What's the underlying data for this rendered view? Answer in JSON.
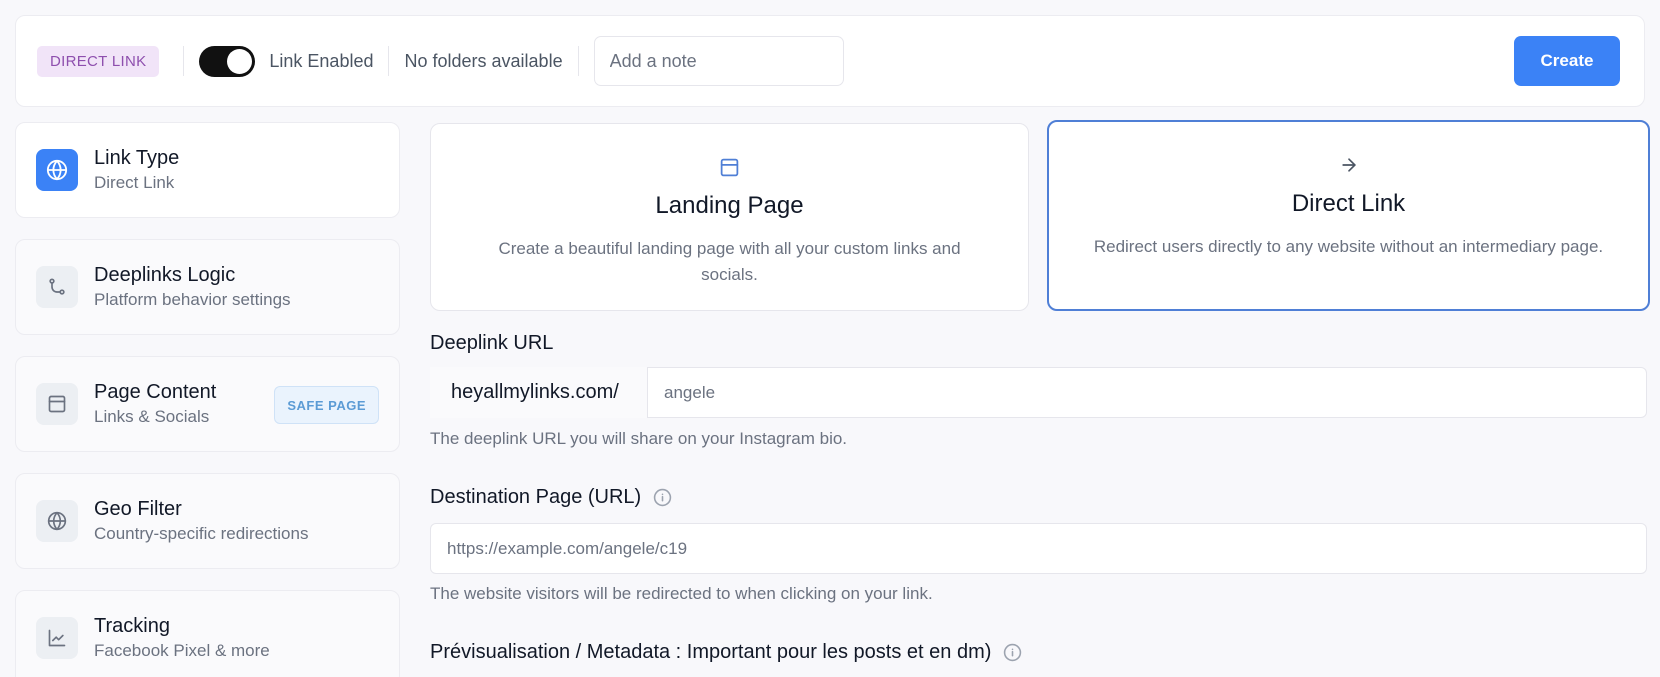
{
  "topbar": {
    "badge": "DIRECT LINK",
    "toggle_label": "Link Enabled",
    "toggle_on": true,
    "folders_text": "No folders available",
    "note_placeholder": "Add a note",
    "create_label": "Create"
  },
  "sidebar": {
    "items": [
      {
        "title": "Link Type",
        "subtitle": "Direct Link",
        "icon": "globe-icon",
        "active": true
      },
      {
        "title": "Deeplinks Logic",
        "subtitle": "Platform behavior settings",
        "icon": "git-branch-icon"
      },
      {
        "title": "Page Content",
        "subtitle": "Links & Socials",
        "icon": "layout-icon",
        "badge": "SAFE PAGE"
      },
      {
        "title": "Geo Filter",
        "subtitle": "Country-specific redirections",
        "icon": "globe-icon"
      },
      {
        "title": "Tracking",
        "subtitle": "Facebook Pixel & more",
        "icon": "chart-line-icon"
      }
    ]
  },
  "link_types": {
    "landing": {
      "title": "Landing Page",
      "description": "Create a beautiful landing page with all your custom links and socials.",
      "icon": "layout-icon"
    },
    "direct": {
      "title": "Direct Link",
      "description": "Redirect users directly to any website without an intermediary page.",
      "icon": "arrow-right-icon",
      "selected": true
    }
  },
  "deeplink": {
    "label": "Deeplink URL",
    "prefix": "heyallmylinks.com/",
    "placeholder": "angele",
    "help": "The deeplink URL you will share on your Instagram bio."
  },
  "destination": {
    "label": "Destination Page (URL)",
    "placeholder": "https://example.com/angele/c19",
    "help": "The website visitors will be redirected to when clicking on your link."
  },
  "preview": {
    "label": "Prévisualisation / Metadata : Important pour les posts et en dm)"
  },
  "colors": {
    "accent": "#3b82f6",
    "selected_border": "#4f7fd6",
    "badge_bg": "#f1e4f8",
    "badge_text": "#8e4fae"
  }
}
